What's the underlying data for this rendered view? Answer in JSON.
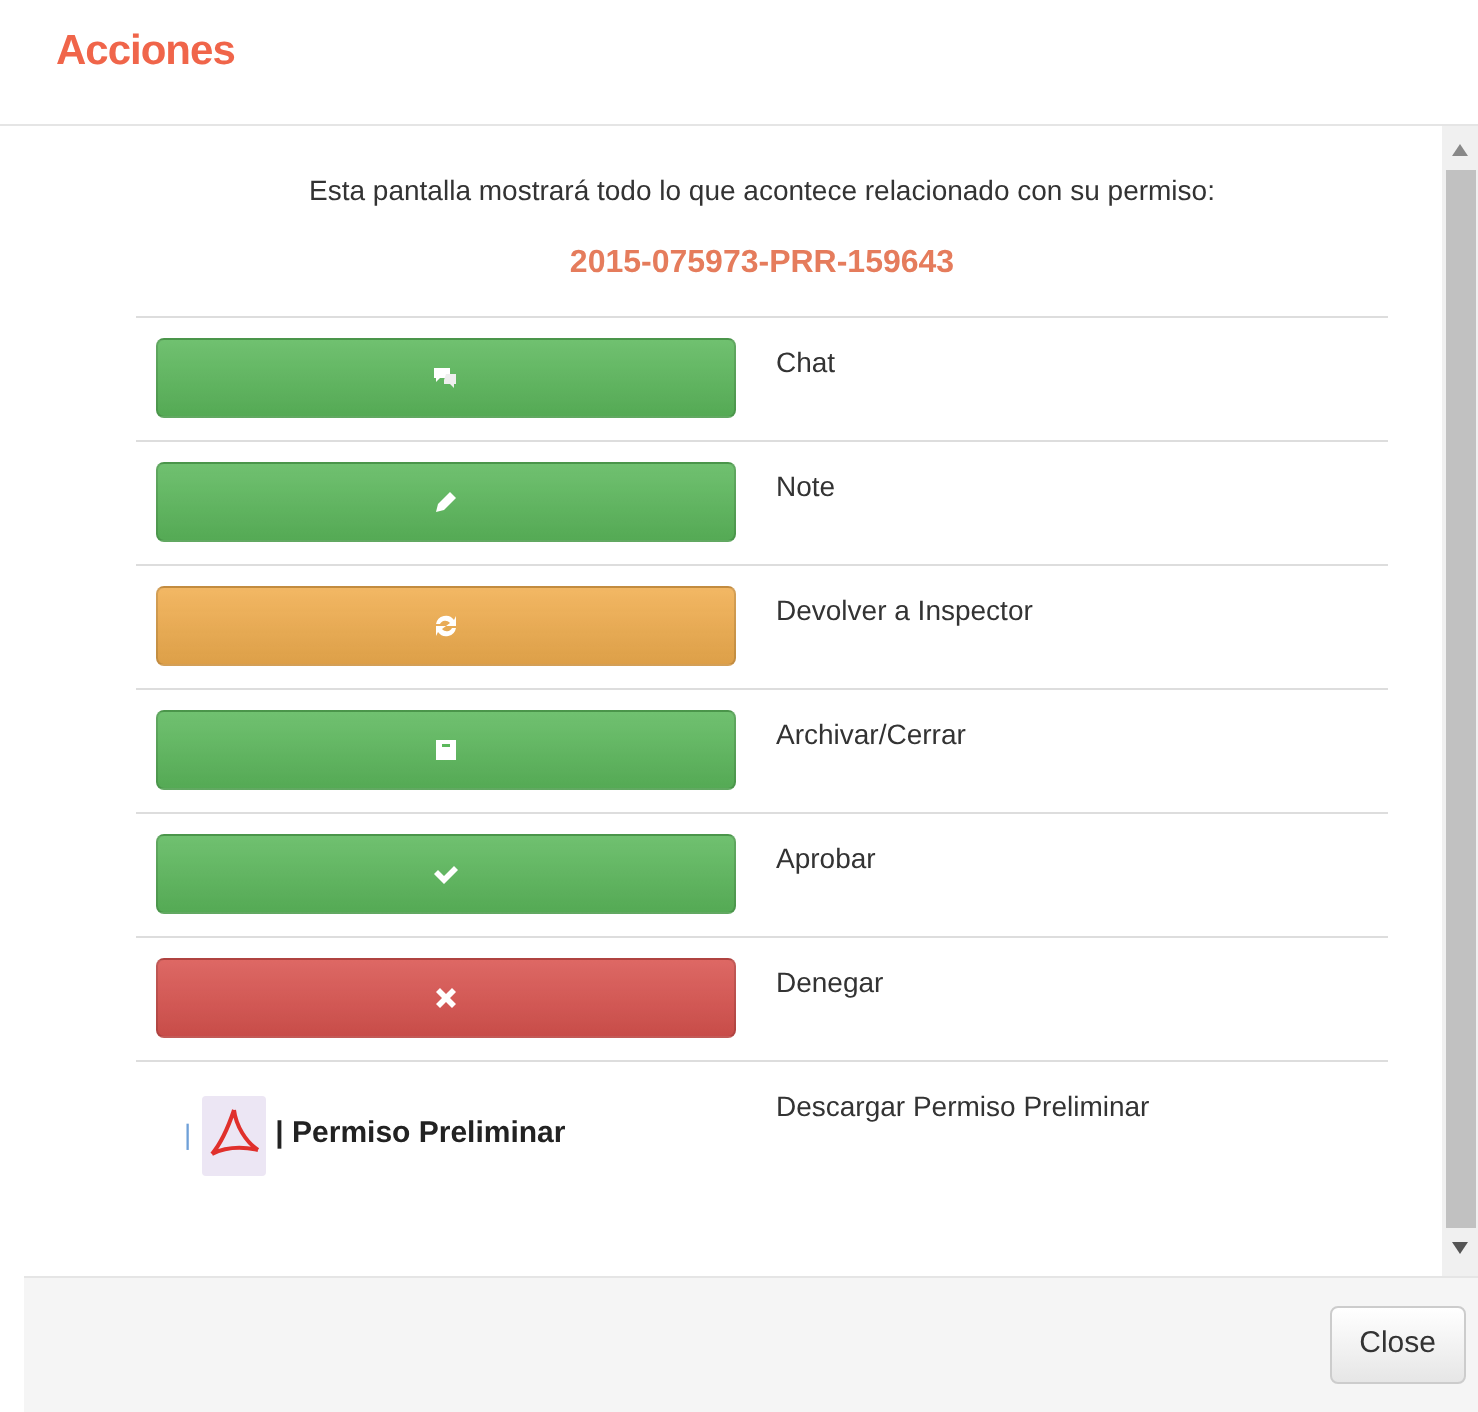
{
  "title": "Acciones",
  "intro": "Esta pantalla mostrará todo lo que acontece relacionado con su permiso:",
  "permit_number": "2015-075973-PRR-159643",
  "actions": [
    {
      "kind": "chat",
      "color": "#5cb85c",
      "description": "Chat"
    },
    {
      "kind": "note",
      "color": "#5cb85c",
      "description": "Note"
    },
    {
      "kind": "return",
      "color": "#f0ad4e",
      "description": "Devolver a Inspector"
    },
    {
      "kind": "archive",
      "color": "#5cb85c",
      "description": "Archivar/Cerrar"
    },
    {
      "kind": "approve",
      "color": "#5cb85c",
      "description": "Aprobar"
    },
    {
      "kind": "deny",
      "color": "#d9534f",
      "description": "Denegar"
    },
    {
      "kind": "download",
      "separator": "|",
      "link": "| Permiso Preliminar",
      "description": "Descargar Permiso Preliminar"
    }
  ],
  "footer": {
    "close_button": "Close"
  }
}
